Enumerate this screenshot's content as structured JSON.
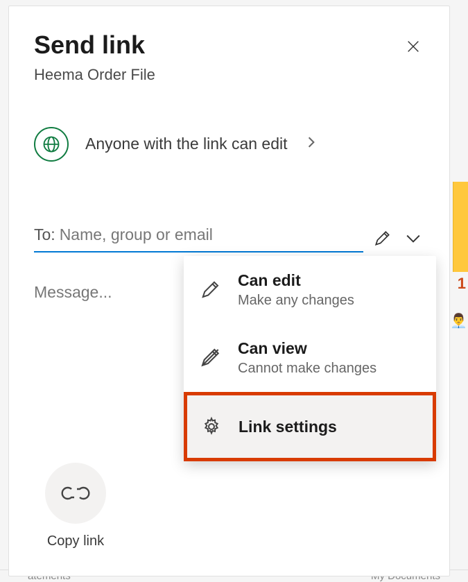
{
  "dialog": {
    "title": "Send link",
    "subtitle": "Heema Order File",
    "close_aria": "Close"
  },
  "permission": {
    "text": "Anyone with the link can edit"
  },
  "to": {
    "label": "To:",
    "placeholder": "Name, group or email"
  },
  "message": {
    "placeholder": "Message..."
  },
  "dropdown": {
    "items": [
      {
        "title": "Can edit",
        "sub": "Make any changes",
        "icon": "pencil-icon"
      },
      {
        "title": "Can view",
        "sub": "Cannot make changes",
        "icon": "pencil-slash-icon"
      },
      {
        "title": "Link settings",
        "sub": "",
        "icon": "gear-icon",
        "highlighted": true
      }
    ]
  },
  "copy_link": {
    "label": "Copy link"
  },
  "background": {
    "left_label": "atements",
    "right_label": "My Documents",
    "badge_number": "1"
  }
}
